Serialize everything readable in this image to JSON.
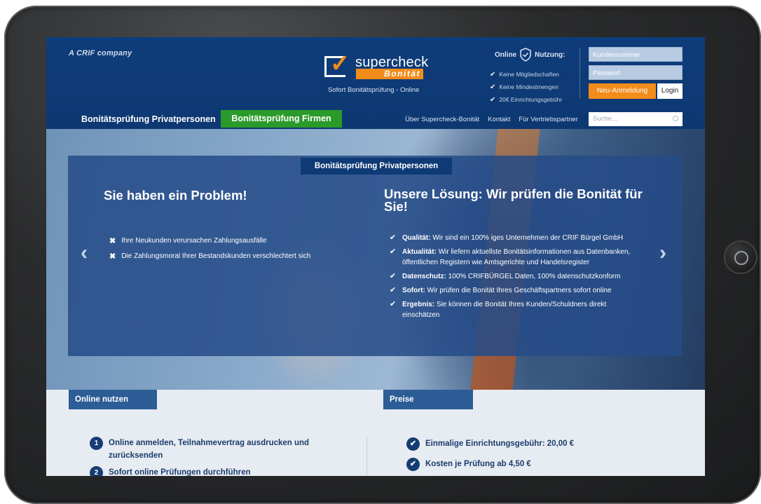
{
  "header": {
    "crif": "A CRIF company",
    "logo_word": "supercheck",
    "logo_sub": "Bonität",
    "tagline": "Sofort Bonitätsprüfung - Online",
    "online_label": "Online",
    "nutzung_label": "Nutzung:",
    "benefits": [
      "Keine Mitgliedschaften",
      "Keine Mindestmengen",
      "20€ Einrichtungsgebühr"
    ],
    "customer_number_placeholder": "Kundennummer",
    "password_placeholder": "Passwort",
    "register_label": "Neu-Anmeldung",
    "login_label": "Login"
  },
  "nav": {
    "private": "Bonitätsprüfung Privatpersonen",
    "companies": "Bonitätsprüfung Firmen",
    "links": [
      "Über Supercheck-Bonität",
      "Kontakt",
      "Für Vertriebspartner"
    ],
    "search_placeholder": "Suche..."
  },
  "hero": {
    "label": "Bonitätsprüfung Privatpersonen",
    "problem_title": "Sie haben ein Problem!",
    "solution_title": "Unsere Lösung: Wir prüfen die Bonität für Sie!",
    "problems": [
      "Ihre Neukunden verursachen Zahlungsausfälle",
      "Die Zahlungsmoral Ihrer Bestandskunden verschlechtert sich"
    ],
    "solutions": [
      {
        "key": "Qualität:",
        "text": "Wir sind ein 100% iges Unternehmen der CRIF Bürgel GmbH"
      },
      {
        "key": "Aktualität:",
        "text": "Wir liefern aktuellste Bonitätsinformationen aus Datenbanken, öffentlichen Registern wie Amtsgerichte und Handelsregister"
      },
      {
        "key": "Datenschutz:",
        "text": "100% CRIFBÜRGEL Daten, 100% datenschutzkonform"
      },
      {
        "key": "Sofort:",
        "text": "Wir prüfen die Bonität Ihres Geschäftspartners sofort online"
      },
      {
        "key": "Ergebnis:",
        "text": "Sie können die Bonität Ihres Kunden/Schuldners direkt einschätzen"
      }
    ]
  },
  "lower": {
    "online_tab": "Online nutzen",
    "preise_tab": "Preise",
    "steps": [
      {
        "num": "1",
        "text": "Online anmelden, Teilnahmevertrag ausdrucken und zurücksenden"
      },
      {
        "num": "2",
        "text": "Sofort online Prüfungen durchführen"
      }
    ],
    "prices": [
      "Einmalige Einrichtungsgebühr: 20,00 €",
      "Kosten je Prüfung ab 4,50 €"
    ]
  },
  "colors": {
    "header_blue": "#0f3d7a",
    "accent_orange": "#f28c1a",
    "firm_green": "#2a9a2a",
    "tab_blue": "#2d5d96"
  }
}
